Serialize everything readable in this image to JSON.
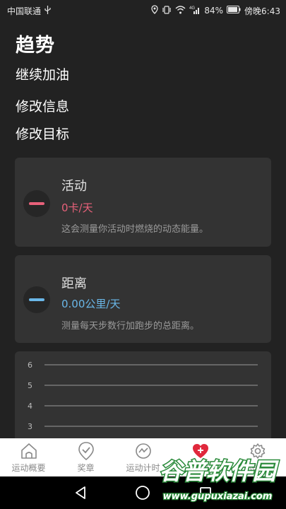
{
  "status_bar": {
    "carrier": "中国联通",
    "usb_icon": "usb-icon",
    "battery": "84%",
    "time": "傍晚6:43",
    "icons": [
      "location-icon",
      "vibrate-icon",
      "wifi-icon",
      "signal-icon",
      "battery-icon"
    ]
  },
  "header": {
    "title": "趋势",
    "menu": [
      "继续加油",
      "修改信息",
      "修改目标"
    ]
  },
  "activity_card": {
    "title": "活动",
    "value": "0卡/天",
    "description": "这会测量你活动时燃烧的动态能量。",
    "accent_color": "#e8617a"
  },
  "distance_card": {
    "title": "距离",
    "value": "0.00公里/天",
    "description": "测量每天步数行加跑步的总距离。",
    "accent_color": "#6ab7e8"
  },
  "chart_data": {
    "type": "line",
    "y_ticks": [
      "6",
      "5",
      "4",
      "3"
    ],
    "ylim": [
      3,
      6
    ],
    "series": [],
    "grid": true
  },
  "bottom_nav": {
    "items": [
      {
        "label": "运动概要",
        "icon": "house-icon",
        "active": false
      },
      {
        "label": "奖章",
        "icon": "badge-check-icon",
        "active": false
      },
      {
        "label": "运动计时",
        "icon": "trend-icon",
        "active": false
      },
      {
        "label": "趋势",
        "icon": "heart-plus-icon",
        "active": true
      },
      {
        "label": "设置",
        "icon": "gear-icon",
        "active": false
      }
    ]
  },
  "watermark": {
    "brand": "谷普软件园",
    "url": "www.gupuxiazai.com"
  },
  "colors": {
    "background": "#222222",
    "card": "#333333",
    "active_red": "#e0283c"
  }
}
